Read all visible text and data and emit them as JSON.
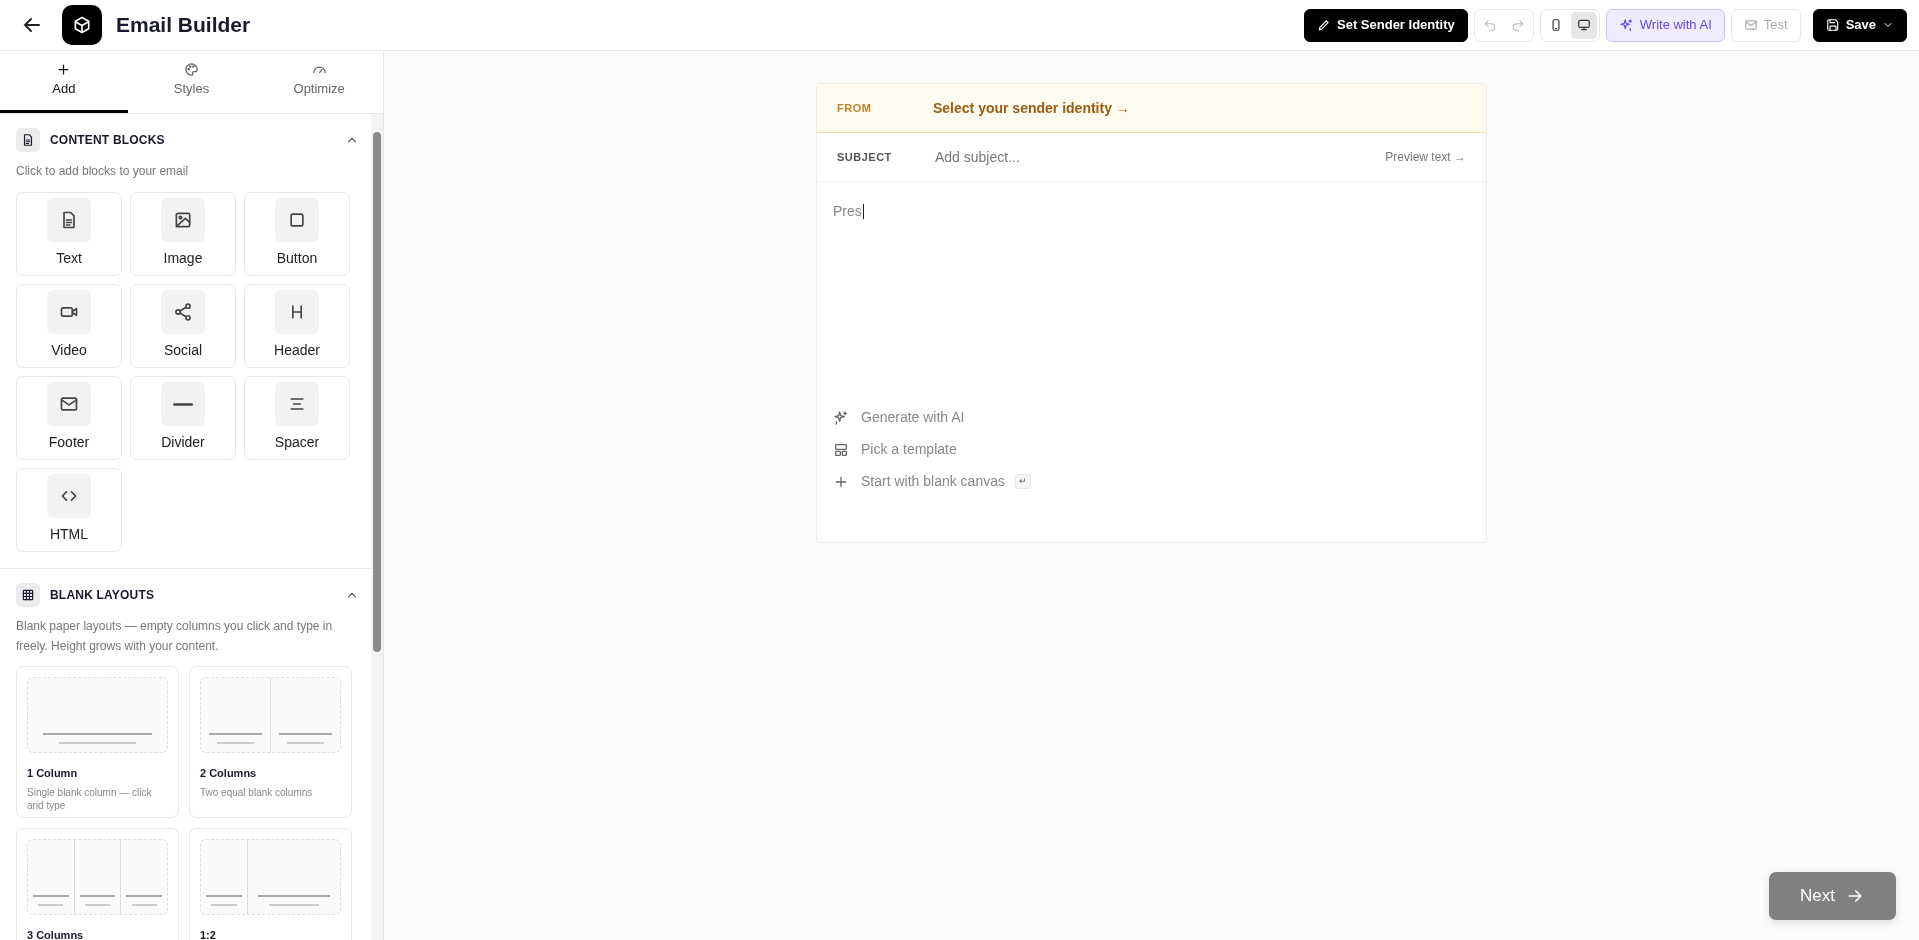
{
  "header": {
    "title": "Email Builder"
  },
  "toolbar": {
    "sender_button": "Set Sender Identity",
    "history": [
      {
        "kind": "undo",
        "disabled": true
      },
      {
        "kind": "redo",
        "disabled": true
      }
    ],
    "devices": [
      {
        "kind": "mobile",
        "selected": false
      },
      {
        "kind": "desktop",
        "selected": true
      }
    ],
    "ai_button": "Write with AI",
    "test_button": {
      "label": "Test",
      "disabled": true
    },
    "save_button": "Save"
  },
  "sidebar": {
    "tabs": [
      {
        "label": "Add",
        "kind": "add",
        "selected": true
      },
      {
        "label": "Styles",
        "kind": "styles",
        "selected": false
      },
      {
        "label": "Optimize",
        "kind": "optimize",
        "selected": false
      }
    ],
    "sections": [
      {
        "kind": "blocks",
        "title": "CONTENT BLOCKS",
        "expanded": true,
        "description": "Click to add blocks to your email",
        "items": [
          {
            "kind": "text",
            "label": "Text"
          },
          {
            "kind": "image",
            "label": "Image"
          },
          {
            "kind": "button",
            "label": "Button"
          },
          {
            "kind": "video",
            "label": "Video"
          },
          {
            "kind": "social",
            "label": "Social"
          },
          {
            "kind": "header",
            "label": "Header"
          },
          {
            "kind": "footer",
            "label": "Footer"
          },
          {
            "kind": "divider",
            "label": "Divider"
          },
          {
            "kind": "spacer",
            "label": "Spacer"
          },
          {
            "kind": "html",
            "label": "HTML"
          }
        ]
      },
      {
        "kind": "layouts",
        "title": "BLANK LAYOUTS",
        "expanded": true,
        "description": "Blank paper layouts — empty columns you click and type in freely. Height grows with your content.",
        "items": [
          {
            "title": "1 Column",
            "description": "Single blank column — click and type",
            "kind": "one"
          },
          {
            "title": "2 Columns",
            "description": "Two equal blank columns",
            "kind": "two"
          },
          {
            "title": "3 Columns",
            "kind": "three"
          },
          {
            "title": "1:2",
            "kind": "one-two"
          }
        ]
      }
    ]
  },
  "email": {
    "from_label": "FROM",
    "from_value": "Select your sender identity →",
    "subject_label": "SUBJECT",
    "subject_placeholder": "Add subject...",
    "preview_link": "Preview text →",
    "body_text": "Pres",
    "actions": [
      {
        "kind": "ai",
        "label": "Generate with AI"
      },
      {
        "kind": "template",
        "label": "Pick a template"
      },
      {
        "kind": "blank",
        "label": "Start with blank canvas",
        "shortcut": "↵"
      }
    ]
  },
  "next_button": "Next"
}
